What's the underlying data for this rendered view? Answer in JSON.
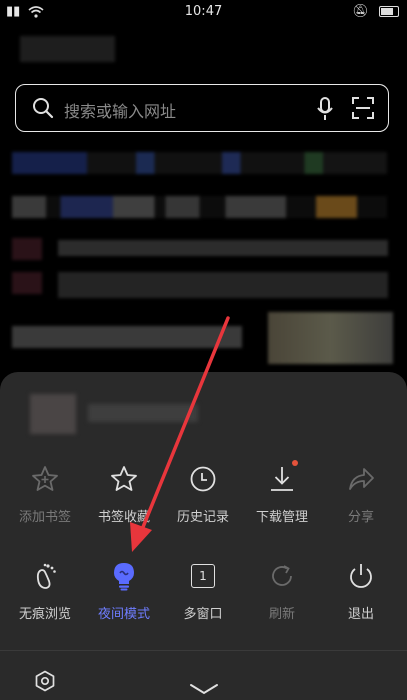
{
  "status_bar": {
    "time": "10:47"
  },
  "search": {
    "placeholder": "搜索或输入网址"
  },
  "menu": {
    "row1": [
      {
        "label": "添加书签",
        "icon": "star-plus-icon",
        "state": "disabled"
      },
      {
        "label": "书签收藏",
        "icon": "star-icon",
        "state": "enabled"
      },
      {
        "label": "历史记录",
        "icon": "clock-icon",
        "state": "enabled"
      },
      {
        "label": "下载管理",
        "icon": "download-icon",
        "state": "enabled"
      },
      {
        "label": "分享",
        "icon": "share-icon",
        "state": "disabled"
      }
    ],
    "row2": [
      {
        "label": "无痕浏览",
        "icon": "footprint-icon",
        "state": "enabled"
      },
      {
        "label": "夜间模式",
        "icon": "night-mode-icon",
        "state": "active"
      },
      {
        "label": "多窗口",
        "icon": "window-count-icon",
        "state": "enabled",
        "badge": "1"
      },
      {
        "label": "刷新",
        "icon": "refresh-icon",
        "state": "disabled"
      },
      {
        "label": "退出",
        "icon": "power-icon",
        "state": "enabled"
      }
    ]
  },
  "colors": {
    "active_accent": "#5a6bff",
    "download_dot": "#e5533b",
    "annotation_arrow": "#e8363c"
  }
}
